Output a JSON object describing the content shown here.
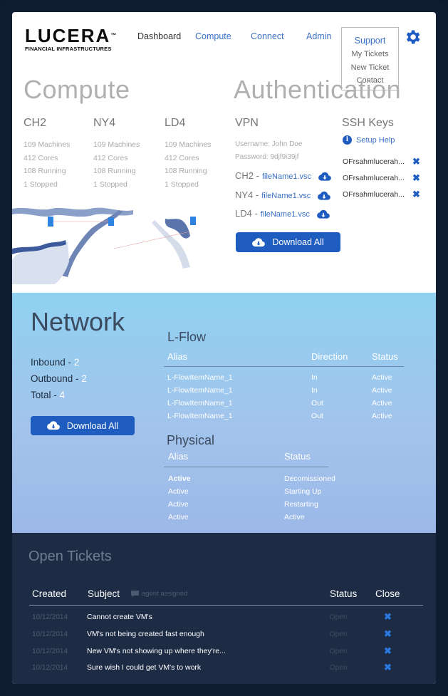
{
  "brand": {
    "name": "LUCERA",
    "subtitle": "FINANCIAL INFRASTRUCTURES",
    "tm": "™"
  },
  "nav": {
    "dashboard": "Dashboard",
    "compute": "Compute",
    "connect": "Connect",
    "admin": "Admin",
    "support": "Support",
    "support_menu": [
      "My Tickets",
      "New Ticket",
      "Contact"
    ]
  },
  "compute": {
    "title": "Compute",
    "datacenters": [
      {
        "name": "CH2",
        "machines": "109 Machines",
        "cores": "412 Cores",
        "running": "108 Running",
        "stopped": "1 Stopped"
      },
      {
        "name": "NY4",
        "machines": "109 Machines",
        "cores": "412 Cores",
        "running": "108 Running",
        "stopped": "1 Stopped"
      },
      {
        "name": "LD4",
        "machines": "109 Machines",
        "cores": "412 Cores",
        "running": "108 Running",
        "stopped": "1 Stopped"
      }
    ]
  },
  "auth": {
    "title": "Authentication",
    "vpn": {
      "title": "VPN",
      "username": "Username: John Doe",
      "password": "Password: 9djf9i39jf",
      "files": [
        {
          "dc": "CH2 -",
          "file": "fileName1.vsc"
        },
        {
          "dc": "NY4 -",
          "file": "fileName1.vsc"
        },
        {
          "dc": "LD4 -",
          "file": "fileName1.vsc"
        }
      ],
      "download_label": "Download All"
    },
    "ssh": {
      "title": "SSH Keys",
      "setup_help": "Setup Help",
      "keys": [
        "OFrsahmlucerah...",
        "OFrsahmlucerah...",
        "OFrsahmlucerah..."
      ]
    }
  },
  "network": {
    "title": "Network",
    "inbound_label": "Inbound -",
    "inbound": "2",
    "outbound_label": "Outbound -",
    "outbound": "2",
    "total_label": "Total -",
    "total": "4",
    "download_label": "Download All",
    "lflow": {
      "title": "L-Flow",
      "headers": [
        "Alias",
        "Direction",
        "Status"
      ],
      "rows": [
        [
          "L-FlowItemName_1",
          "In",
          "Active"
        ],
        [
          "L-FlowItemName_1",
          "In",
          "Active"
        ],
        [
          "L-FlowItemName_1",
          "Out",
          "Active"
        ],
        [
          "L-FlowItemName_1",
          "Out",
          "Active"
        ]
      ]
    },
    "physical": {
      "title": "Physical",
      "headers": [
        "Alias",
        "Status"
      ],
      "rows": [
        [
          "Active",
          "Decomissioned"
        ],
        [
          "Active",
          "Starting Up"
        ],
        [
          "Active",
          "Restarting"
        ],
        [
          "Active",
          "Active"
        ]
      ]
    }
  },
  "tickets": {
    "title": "Open Tickets",
    "headers": {
      "created": "Created",
      "subject": "Subject",
      "agent": "agent assigned",
      "status": "Status",
      "close": "Close"
    },
    "rows": [
      {
        "date": "10/12/2014",
        "subject": "Cannot create VM's",
        "status": "Open"
      },
      {
        "date": "10/12/2014",
        "subject": "VM's not being created fast enough",
        "status": "Open"
      },
      {
        "date": "10/12/2014",
        "subject": "New VM's not showing up where they're...",
        "status": "Open"
      },
      {
        "date": "10/12/2014",
        "subject": "Sure wish I could get VM's to work",
        "status": "Open"
      }
    ]
  },
  "colors": {
    "accent": "#1f5cbf",
    "link": "#3a6fc4",
    "dark": "#1d2b44"
  }
}
